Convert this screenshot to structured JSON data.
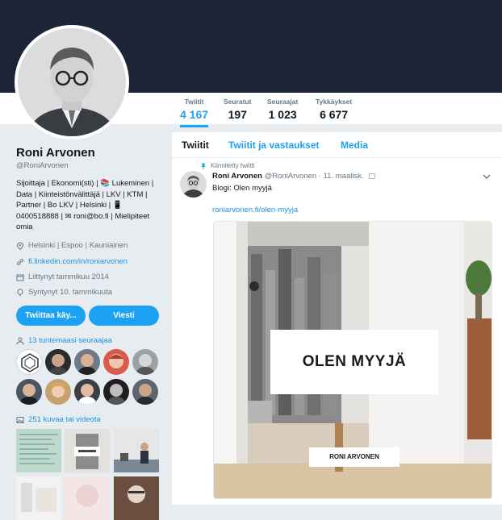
{
  "stats": [
    {
      "label": "Twiitit",
      "value": "4 167",
      "active": true
    },
    {
      "label": "Seuratut",
      "value": "197"
    },
    {
      "label": "Seuraajat",
      "value": "1 023"
    },
    {
      "label": "Tykkäykset",
      "value": "6 677"
    }
  ],
  "profile": {
    "name": "Roni Arvonen",
    "handle": "@RoniArvonen",
    "bio_lines": [
      "Sijoittaja | Ekonomi(sti) | 📚 Lukeminen |",
      "Data | Kiinteistönvälittäjä | LKV | KTM |",
      "Partner | Bo LKV | Helsinki | 📱",
      "0400518888 | ✉ roni@bo.fi | Mielipiteet",
      "omia"
    ],
    "location": "Helsinki | Espoo | Kauniainen",
    "website": "fi.linkedin.com/in/roniarvonen",
    "joined": "Liittynyt tammikuu 2014",
    "born": "Syntynyt 10. tammikuuta"
  },
  "buttons": {
    "tweet_to": "Twiittaa käy...",
    "message": "Viesti"
  },
  "followers_you_know": "13 tuntemaasi seuraajaa",
  "photos_videos": "251 kuvaa tai videota",
  "tabs": [
    "Twiitit",
    "Twiitit ja vastaukset",
    "Media"
  ],
  "tweet": {
    "pinned_label": "Kiinnitetty twiitti",
    "author": "Roni Arvonen",
    "handle": "@RoniArvonen",
    "date": "· 11. maalisk.",
    "text": "Blogi: Olen myyjä",
    "link": "roniarvonen.fi/olen-myyja",
    "card_title": "OLEN MYYJÄ",
    "card_subtitle": "RONI ARVONEN"
  },
  "colors": {
    "accent": "#1da1f2",
    "banner": "#1b2535",
    "background": "#e6ecf0"
  }
}
